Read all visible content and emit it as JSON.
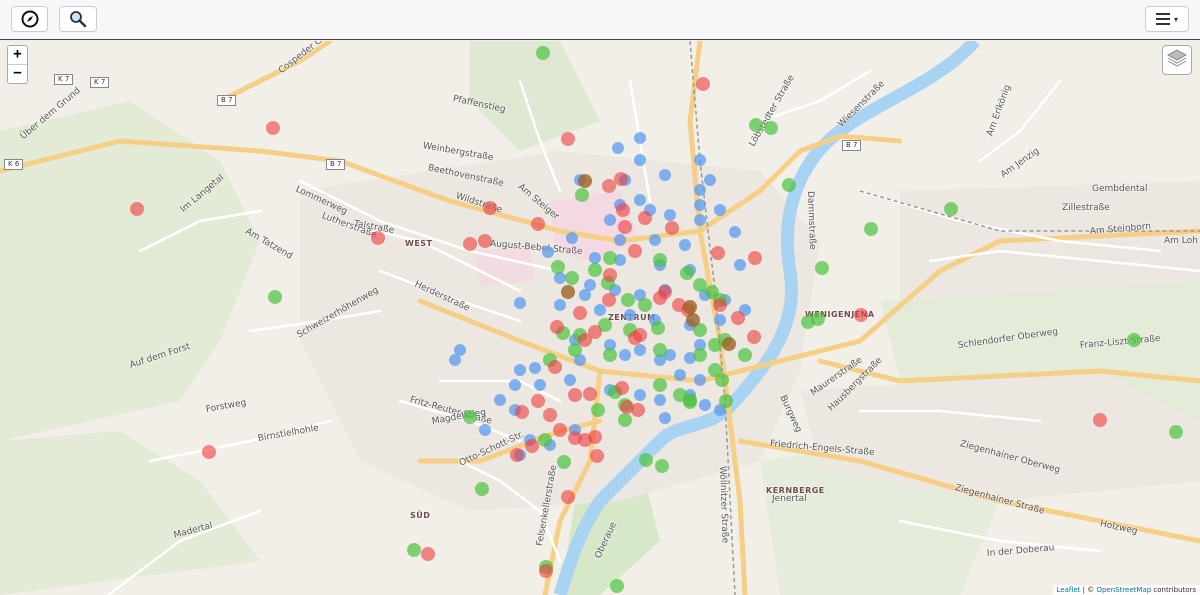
{
  "navbar": {
    "compass_icon": "compass-icon",
    "search_icon": "search-icon",
    "menu_icon": "hamburger-menu-icon",
    "menu_caret": "▾"
  },
  "map_controls": {
    "zoom_in": "+",
    "zoom_out": "−",
    "layers_icon": "layers-icon"
  },
  "attribution": {
    "leaflet": "Leaflet",
    "separator": " | © ",
    "osm": "OpenStreetMap",
    "suffix": " contributors"
  },
  "colors": {
    "blue": "#5b9bf0",
    "green": "#4cc43f",
    "red": "#ef3e3e",
    "brown": "#a0622a",
    "road_major": "#f8d98e",
    "river": "#a9d3f2"
  },
  "districts": [
    "WEST",
    "ZENTRUM",
    "WENIGENJENA",
    "SÜD",
    "KERNBERGE"
  ],
  "street_labels": [
    "Cospeder Grund",
    "Über dem Grund",
    "Pfaffenstieg",
    "Weinbergstraße",
    "Beethovenstraße",
    "Wildstraße",
    "Am Steiger",
    "Lommerweg",
    "Talstraße",
    "Lutherstraße",
    "August-Bebel-Straße",
    "Im Langetal",
    "Am Tatzend",
    "Herderstraße",
    "Schweizerhöhenweg",
    "Auf dem Forst",
    "Forstweg",
    "Fritz-Reuter-Straße",
    "Magdelstieg",
    "Otto-Schott-Str.",
    "Birnstielhohle",
    "Madertal",
    "Felsenkellerstraße",
    "Oberaue",
    "Wöllnitzer Straße",
    "Friedrich-Engels-Straße",
    "Schlendorfer Oberweg",
    "Franz-Liszt-Straße",
    "Ziegenhainer Oberweg",
    "Ziegenhainer Straße",
    "Holzweg",
    "In der Doberau",
    "Am Steinborn",
    "Am Jenzig",
    "Gembdental",
    "Zillestraße",
    "Am Erlkönig",
    "Dammstraße",
    "Wiesenstraße",
    "Löbstedter Straße",
    "Maurerstraße",
    "Burgweg",
    "Hausbergstraße",
    "Am Loh",
    "Jenertal"
  ],
  "road_refs": [
    "K 7",
    "K 7",
    "B 7",
    "B 7",
    "B 7",
    "K 6"
  ]
}
